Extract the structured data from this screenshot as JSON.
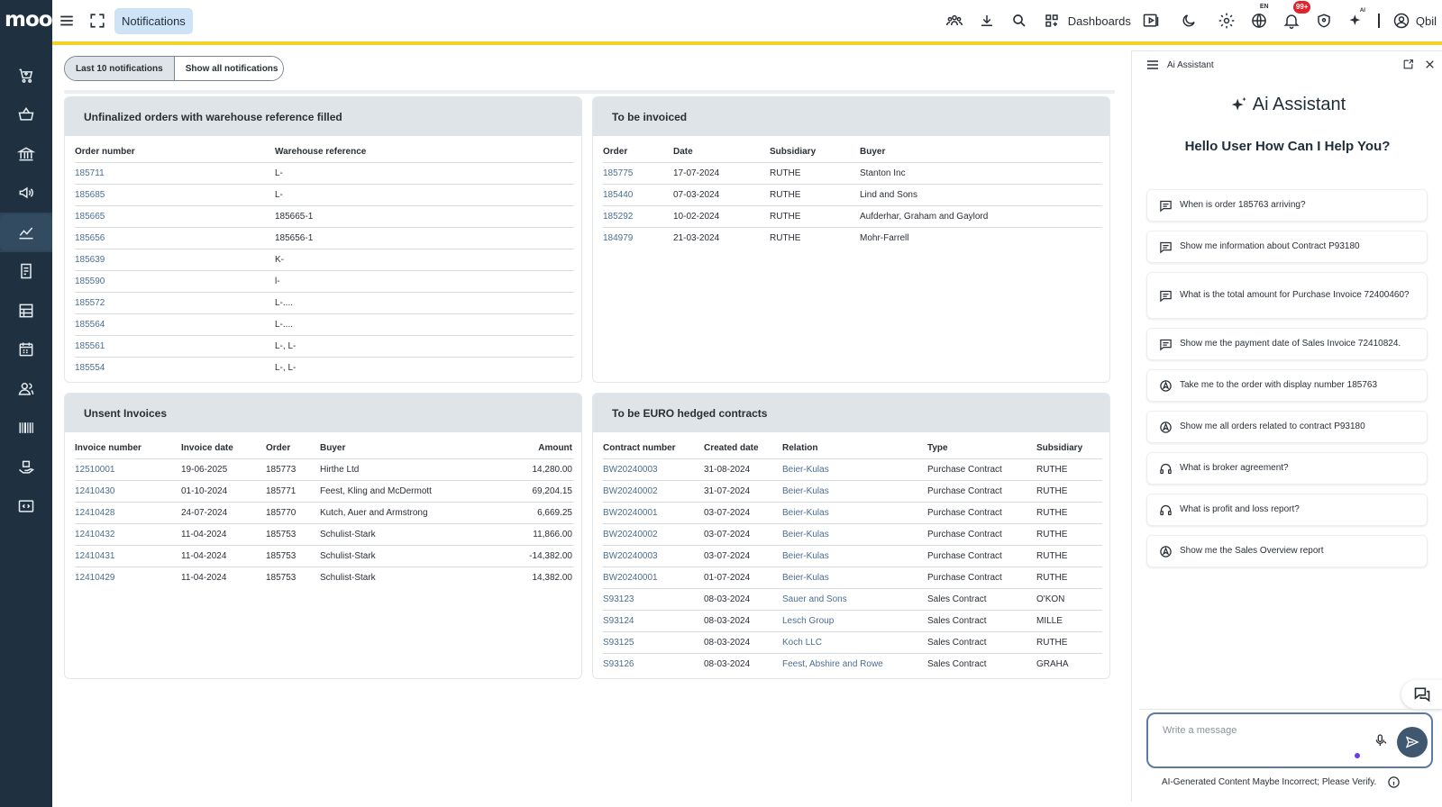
{
  "brand": {
    "logo": "moo"
  },
  "header": {
    "active_tab": "Notifications",
    "dashboards_label": "Dashboards",
    "lang_tag": "EN",
    "notif_badge": "99+",
    "ai_tag": "AI",
    "user_name": "Qbil"
  },
  "toggle": {
    "last10": "Last 10 notifications",
    "showall": "Show all notifications"
  },
  "cards": {
    "unfinalized": {
      "title": "Unfinalized orders with warehouse reference filled",
      "headers": [
        "Order number",
        "Warehouse reference"
      ],
      "rows": [
        [
          "185711",
          "L-"
        ],
        [
          "185685",
          "L-"
        ],
        [
          "185665",
          "185665-1"
        ],
        [
          "185656",
          "185656-1"
        ],
        [
          "185639",
          "K-"
        ],
        [
          "185590",
          "l-"
        ],
        [
          "185572",
          "L-...."
        ],
        [
          "185564",
          "L-...."
        ],
        [
          "185561",
          "L-, L-"
        ],
        [
          "185554",
          "L-, L-"
        ]
      ]
    },
    "to_invoice": {
      "title": "To be invoiced",
      "headers": [
        "Order",
        "Date",
        "Subsidiary",
        "Buyer"
      ],
      "rows": [
        [
          "185775",
          "17-07-2024",
          "RUTHE",
          "Stanton Inc"
        ],
        [
          "185440",
          "07-03-2024",
          "RUTHE",
          "Lind and Sons"
        ],
        [
          "185292",
          "10-02-2024",
          "RUTHE",
          "Aufderhar, Graham and Gaylord"
        ],
        [
          "184979",
          "21-03-2024",
          "RUTHE",
          "Mohr-Farrell"
        ]
      ]
    },
    "unsent": {
      "title": "Unsent Invoices",
      "headers": [
        "Invoice number",
        "Invoice date",
        "Order",
        "Buyer",
        "Amount"
      ],
      "rows": [
        [
          "12510001",
          "19-06-2025",
          "185773",
          "Hirthe Ltd",
          "14,280.00"
        ],
        [
          "12410430",
          "01-10-2024",
          "185771",
          "Feest, Kling and McDermott",
          "69,204.15"
        ],
        [
          "12410428",
          "24-07-2024",
          "185770",
          "Kutch, Auer and Armstrong",
          "6,669.25"
        ],
        [
          "12410432",
          "11-04-2024",
          "185753",
          "Schulist-Stark",
          "11,866.00"
        ],
        [
          "12410431",
          "11-04-2024",
          "185753",
          "Schulist-Stark",
          "-14,382.00"
        ],
        [
          "12410429",
          "11-04-2024",
          "185753",
          "Schulist-Stark",
          "14,382.00"
        ]
      ]
    },
    "euro": {
      "title": "To be EURO hedged contracts",
      "headers": [
        "Contract number",
        "Created date",
        "Relation",
        "Type",
        "Subsidiary"
      ],
      "rows": [
        [
          "BW20240003",
          "31-08-2024",
          "Beier-Kulas",
          "Purchase Contract",
          "RUTHE"
        ],
        [
          "BW20240002",
          "31-07-2024",
          "Beier-Kulas",
          "Purchase Contract",
          "RUTHE"
        ],
        [
          "BW20240001",
          "03-07-2024",
          "Beier-Kulas",
          "Purchase Contract",
          "RUTHE"
        ],
        [
          "BW20240002",
          "03-07-2024",
          "Beier-Kulas",
          "Purchase Contract",
          "RUTHE"
        ],
        [
          "BW20240003",
          "03-07-2024",
          "Beier-Kulas",
          "Purchase Contract",
          "RUTHE"
        ],
        [
          "BW20240001",
          "01-07-2024",
          "Beier-Kulas",
          "Purchase Contract",
          "RUTHE"
        ],
        [
          "S93123",
          "08-03-2024",
          "Sauer and Sons",
          "Sales Contract",
          "O'KON"
        ],
        [
          "S93124",
          "08-03-2024",
          "Lesch Group",
          "Sales Contract",
          "MILLE"
        ],
        [
          "S93125",
          "08-03-2024",
          "Koch LLC",
          "Sales Contract",
          "RUTHE"
        ],
        [
          "S93126",
          "08-03-2024",
          "Feest, Abshire and Rowe",
          "Sales Contract",
          "GRAHA"
        ]
      ]
    }
  },
  "ai": {
    "top_label": "Ai Assistant",
    "brand": "Ai Assistant",
    "greeting": "Hello User How Can I Help You?",
    "suggestions": [
      {
        "icon": "chat",
        "text": "When is order 185763 arriving?"
      },
      {
        "icon": "chat",
        "text": "Show me information about Contract P93180"
      },
      {
        "icon": "chat",
        "text": "What is the total amount for Purchase Invoice 72400460?"
      },
      {
        "icon": "chat",
        "text": "Show me the payment date of Sales Invoice 72410824."
      },
      {
        "icon": "navigate",
        "text": "Take me to the order with display number 185763"
      },
      {
        "icon": "navigate",
        "text": "Show me all orders related to contract P93180"
      },
      {
        "icon": "support",
        "text": "What is broker agreement?"
      },
      {
        "icon": "support",
        "text": "What is profit and loss report?"
      },
      {
        "icon": "navigate",
        "text": "Show me the Sales Overview report"
      }
    ],
    "placeholder": "Write a message",
    "disclaimer": "AI-Generated Content Maybe Incorrect; Please Verify."
  }
}
